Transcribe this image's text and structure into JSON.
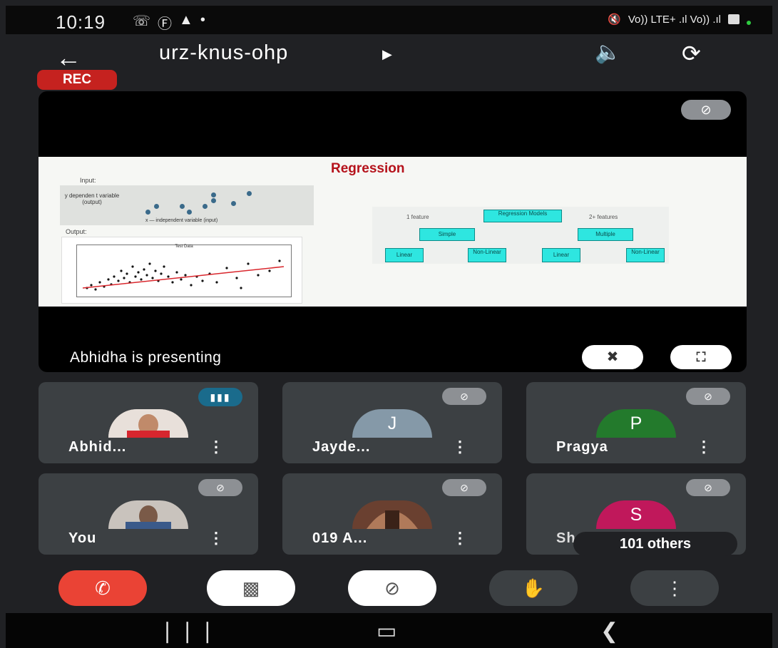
{
  "status_bar": {
    "time": "10:19",
    "left_icons": [
      "whatsapp-icon",
      "b-icon",
      "alert-icon",
      "dot-icon"
    ],
    "network_text": "Vo)) LTE+ .ıl Vo)) .ıl"
  },
  "header": {
    "meeting_code": "urz-knus-ohp",
    "rec_label": "REC"
  },
  "presentation": {
    "presenter_text": "Abhidha is presenting",
    "slide": {
      "title": "Regression",
      "input_label": "Input:",
      "y_label": "y dependen t variable (output)",
      "x_label": "x — independent variable (input)",
      "output_label": "Output:",
      "plot_title": "Test Data",
      "tree": {
        "root": "Regression Models",
        "left_feature": "1 feature",
        "right_feature": "2+ features",
        "simple": "Simple",
        "multiple": "Multiple",
        "leaves": [
          "Linear",
          "Non-Linear",
          "Linear",
          "Non-Linear"
        ]
      }
    }
  },
  "participants": [
    {
      "name": "Abhid...",
      "state": "speaking",
      "avatar": "photo"
    },
    {
      "name": "Jayde...",
      "state": "muted",
      "avatar": "J",
      "color": "#8599a8"
    },
    {
      "name": "Pragya",
      "state": "muted",
      "avatar": "P",
      "color": "#237a2c"
    },
    {
      "name": "You",
      "state": "muted",
      "avatar": "photo"
    },
    {
      "name": "019 A...",
      "state": "muted",
      "avatar": "photo"
    },
    {
      "name": "Sh...",
      "state": "muted",
      "avatar": "S",
      "color": "#c0185b",
      "others": "101 others"
    }
  ],
  "colors": {
    "rec": "#c5221f",
    "end_call": "#ea4335",
    "tile_bg": "#3c4043",
    "speaking": "#1a6b8c"
  }
}
